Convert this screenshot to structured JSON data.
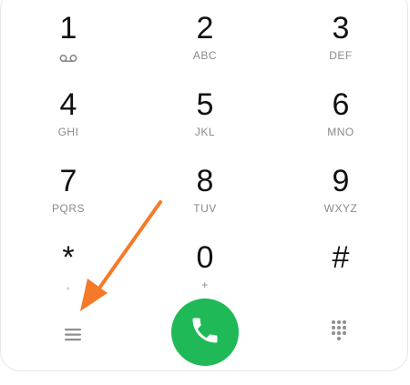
{
  "keypad": {
    "keys": [
      {
        "digit": "1",
        "letters": "",
        "sub_icon": "voicemail-icon"
      },
      {
        "digit": "2",
        "letters": "ABC"
      },
      {
        "digit": "3",
        "letters": "DEF"
      },
      {
        "digit": "4",
        "letters": "GHI"
      },
      {
        "digit": "5",
        "letters": "JKL"
      },
      {
        "digit": "6",
        "letters": "MNO"
      },
      {
        "digit": "7",
        "letters": "PQRS"
      },
      {
        "digit": "8",
        "letters": "TUV"
      },
      {
        "digit": "9",
        "letters": "WXYZ"
      },
      {
        "digit": "*",
        "letters": ","
      },
      {
        "digit": "0",
        "letters": "+"
      },
      {
        "digit": "#",
        "letters": ""
      }
    ]
  },
  "bottom_bar": {
    "menu_icon": "hamburger-menu-icon",
    "call_icon": "phone-icon",
    "dialpad_icon": "dialpad-grid-icon"
  },
  "colors": {
    "call_button": "#1fb957",
    "arrow": "#f47a2a",
    "letters": "#8a8a8a",
    "icons": "#8f8f8f"
  }
}
